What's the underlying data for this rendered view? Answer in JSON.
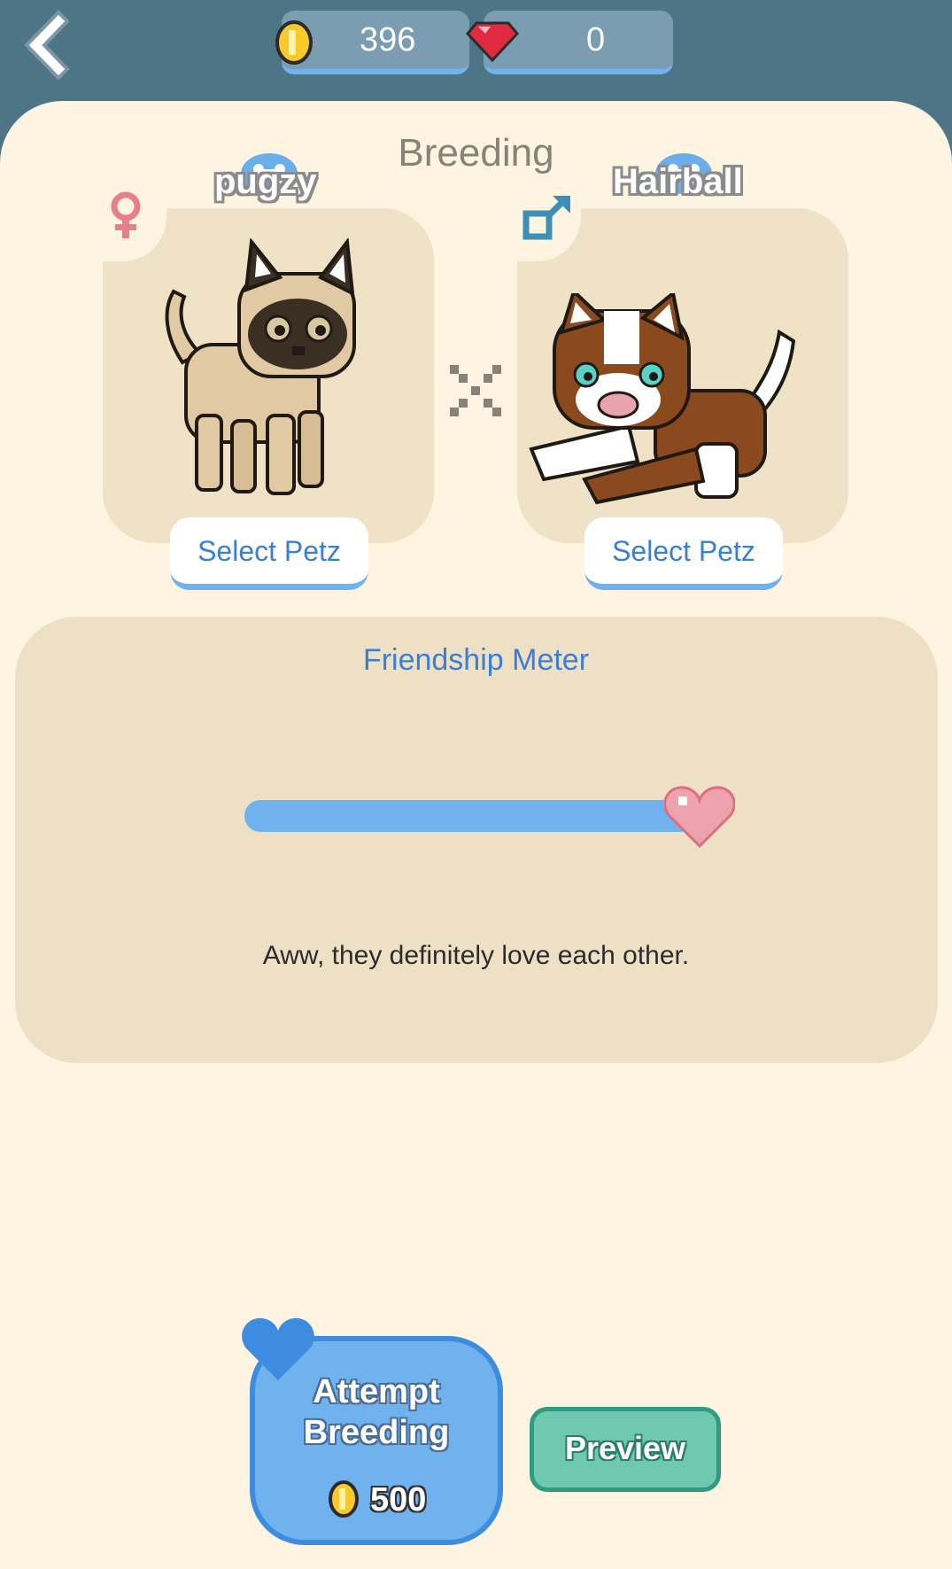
{
  "header": {
    "coins": "396",
    "gems": "0",
    "back_icon": "chevron-left-icon",
    "coin_icon": "gold-coin-icon",
    "gem_icon": "red-gem-icon"
  },
  "page": {
    "title": "Breeding"
  },
  "parents": [
    {
      "name": "pugzy",
      "gender": "female",
      "gender_icon": "female-symbol-icon",
      "select_label": "Select Petz",
      "fur": "#e0c9a3",
      "accent": "#3b2e22"
    },
    {
      "name": "Hairball",
      "gender": "male",
      "gender_icon": "male-symbol-icon",
      "select_label": "Select Petz",
      "fur": "#8b4a1e",
      "accent": "#ffffff"
    }
  ],
  "friendship": {
    "title": "Friendship Meter",
    "level": 1.0,
    "message": "Aww, they definitely love each other."
  },
  "actions": {
    "attempt_line1": "Attempt",
    "attempt_line2": "Breeding",
    "attempt_cost": "500",
    "preview_label": "Preview"
  },
  "colors": {
    "header_bg": "#4d7585",
    "panel_bg": "#fdf5e2",
    "card_bg": "#efe2c6",
    "accent_blue": "#6fb2ee",
    "text_blue": "#3a7fd6",
    "preview_green": "#6ec9b0"
  }
}
